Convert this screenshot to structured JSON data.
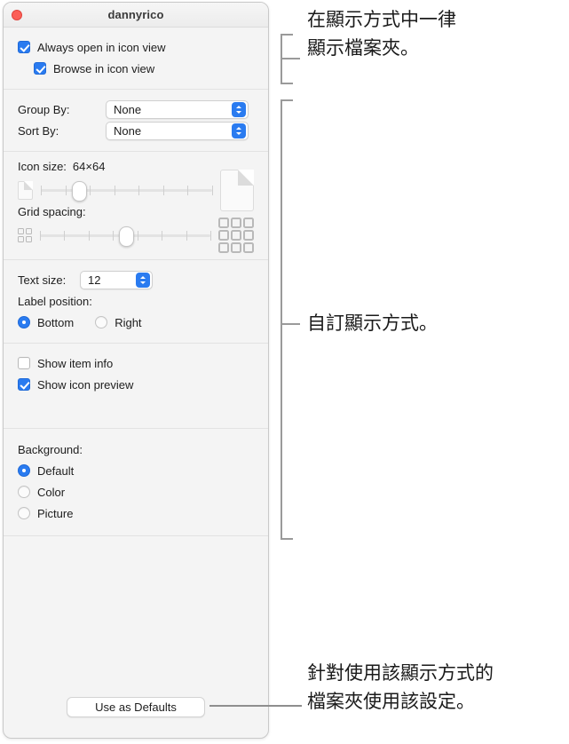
{
  "window": {
    "title": "dannyrico",
    "close_button": "close"
  },
  "view_options": {
    "always_open": {
      "label": "Always open in icon view",
      "checked": true
    },
    "browse_icon_view": {
      "label": "Browse in icon view",
      "checked": true
    },
    "group_by": {
      "label": "Group By:",
      "value": "None"
    },
    "sort_by": {
      "label": "Sort By:",
      "value": "None"
    },
    "icon_size": {
      "label": "Icon size:",
      "value": "64×64",
      "ticks": 8,
      "thumb_percent": 22
    },
    "grid_spacing": {
      "label": "Grid spacing:",
      "ticks": 8,
      "thumb_percent": 50
    },
    "text_size": {
      "label": "Text size:",
      "value": "12"
    },
    "label_position": {
      "label": "Label position:",
      "options": [
        {
          "label": "Bottom",
          "selected": true
        },
        {
          "label": "Right",
          "selected": false
        }
      ]
    },
    "show_item_info": {
      "label": "Show item info",
      "checked": false
    },
    "show_icon_preview": {
      "label": "Show icon preview",
      "checked": true
    },
    "background": {
      "label": "Background:",
      "options": [
        {
          "label": "Default",
          "selected": true
        },
        {
          "label": "Color",
          "selected": false
        },
        {
          "label": "Picture",
          "selected": false
        }
      ]
    },
    "use_as_defaults": {
      "label": "Use as Defaults"
    }
  },
  "annotations": [
    {
      "text": "在顯示方式中一律\n顯示檔案夾。"
    },
    {
      "text": "自訂顯示方式。"
    },
    {
      "text": "針對使用該顯示方式的\n檔案夾使用該設定。"
    }
  ],
  "colors": {
    "accent": "#2a7bf0",
    "close_button": "#fc5f57",
    "window_background": "#f4f4f4",
    "annotation_line": "#9a9a9a"
  }
}
